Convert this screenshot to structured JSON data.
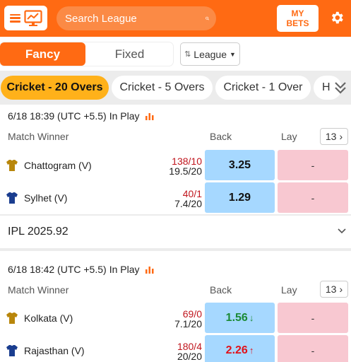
{
  "header": {
    "search_placeholder": "Search League",
    "mybets_label": "MY\nBETS",
    "icons": [
      "hamburger-icon",
      "monitor-icon",
      "search-icon",
      "gear-icon"
    ],
    "colors": {
      "brand": "#ff6a13",
      "search_bg": "#fb8a45"
    }
  },
  "tabs": {
    "fancy_label": "Fancy",
    "fixed_label": "Fixed",
    "league_label": "League"
  },
  "sports": [
    {
      "label": "Cricket - 20 Overs",
      "active": true
    },
    {
      "label": "Cricket - 5 Overs",
      "active": false
    },
    {
      "label": "Cricket - 1 Over",
      "active": false
    },
    {
      "label": "H",
      "active": false
    }
  ],
  "matches": [
    {
      "datetime": "6/18 18:39 (UTC +5.5)",
      "status": "In Play",
      "market": "Match Winner",
      "back_label": "Back",
      "lay_label": "Lay",
      "more_count": "13",
      "runners": [
        {
          "name": "Chattogram (V)",
          "score": "138/10",
          "overs": "19.5/20",
          "back": "3.25",
          "lay": "-",
          "shirt_color": "#b8860b"
        },
        {
          "name": "Sylhet (V)",
          "score": "40/1",
          "overs": "7.4/20",
          "back": "1.29",
          "lay": "-",
          "shirt_color": "#1a3d8f"
        }
      ]
    },
    {
      "datetime": "6/18 18:42 (UTC +5.5)",
      "status": "In Play",
      "market": "Match Winner",
      "back_label": "Back",
      "lay_label": "Lay",
      "more_count": "13",
      "runners": [
        {
          "name": "Kolkata (V)",
          "score": "69/0",
          "overs": "7.1/20",
          "back": "1.56",
          "back_arrow": "↓",
          "back_trend": "up",
          "lay": "-",
          "shirt_color": "#b8860b"
        },
        {
          "name": "Rajasthan (V)",
          "score": "180/4",
          "overs": "20/20",
          "back": "2.26",
          "back_arrow": "↑",
          "back_trend": "down",
          "lay": "-",
          "shirt_color": "#1a3d8f"
        }
      ]
    }
  ],
  "league_group": {
    "title": "IPL 2025.92"
  }
}
